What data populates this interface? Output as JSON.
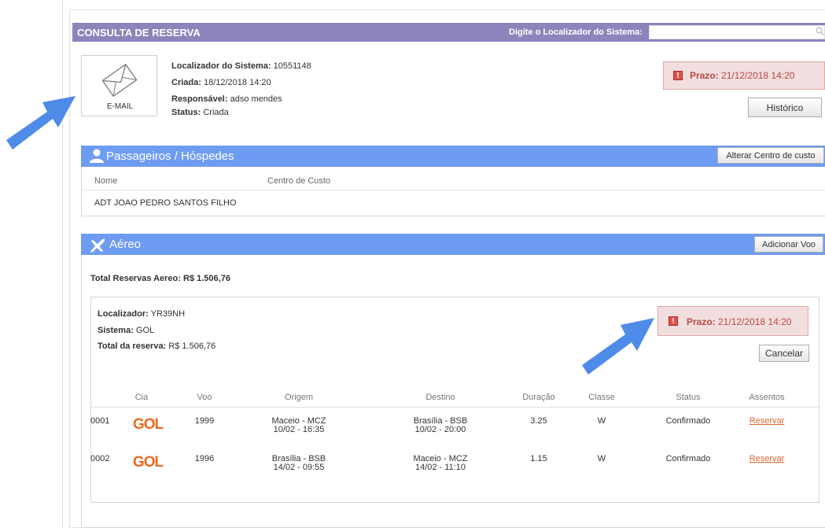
{
  "header": {
    "title": "CONSULTA DE RESERVA",
    "search_label": "Digite o Localizador do Sistema:",
    "search_value": ""
  },
  "reservation": {
    "email_label": "E-MAIL",
    "localizador_label": "Localizador do Sistema:",
    "localizador_value": "10551148",
    "criada_label": "Criada:",
    "criada_value": "18/12/2018 14:20",
    "responsavel_label": "Responsável:",
    "responsavel_value": "adso mendes",
    "status_label": "Status:",
    "status_value": "Criada",
    "prazo_label": "Prazo:",
    "prazo_value": "21/12/2018 14:20",
    "historico_button": "Histórico"
  },
  "passengers": {
    "title": "Passageiros / Hóspedes",
    "alterar_button": "Alterar Centro de custo",
    "col_nome": "Nome",
    "col_centro": "Centro de Custo",
    "rows": [
      {
        "nome": "ADT JOAO PEDRO SANTOS FILHO",
        "centro": ""
      }
    ]
  },
  "aereo": {
    "title": "Aéreo",
    "add_button": "Adicionar Voo",
    "total_label": "Total Reservas Aereo:",
    "total_value": "R$ 1.506,76",
    "booking": {
      "localizador_label": "Localizador:",
      "localizador_value": "YR39NH",
      "sistema_label": "Sistema:",
      "sistema_value": "GOL",
      "total_label": "Total da reserva:",
      "total_value": "R$ 1.506,76",
      "prazo_label": "Prazo:",
      "prazo_value": "21/12/2018 14:20",
      "cancel_button": "Cancelar"
    },
    "columns": [
      "Cia",
      "Voo",
      "Origem",
      "Destino",
      "Duração",
      "Classe",
      "Status",
      "Assentos"
    ],
    "flights": [
      {
        "seq": "0001",
        "cia": "GOL",
        "voo": "1999",
        "origem": "Maceio - MCZ",
        "origem_dt": "10/02 - 16:35",
        "destino": "Brasília - BSB",
        "destino_dt": "10/02 - 20:00",
        "duracao": "3.25",
        "classe": "W",
        "status": "Confirmado",
        "assentos": "Reservar"
      },
      {
        "seq": "0002",
        "cia": "GOL",
        "voo": "1996",
        "origem": "Brasília - BSB",
        "origem_dt": "14/02 - 09:55",
        "destino": "Maceio - MCZ",
        "destino_dt": "14/02 - 11:10",
        "duracao": "1.15",
        "classe": "W",
        "status": "Confirmado",
        "assentos": "Reservar"
      }
    ]
  },
  "colors": {
    "header_bar": "#8c85bb",
    "panel_bar": "#6f9cf3",
    "prazo_bg": "#f2dede",
    "prazo_text": "#b94a48",
    "gol_brand": "#ee6a1e",
    "link": "#e0652d",
    "arrow": "#4f8be8"
  }
}
